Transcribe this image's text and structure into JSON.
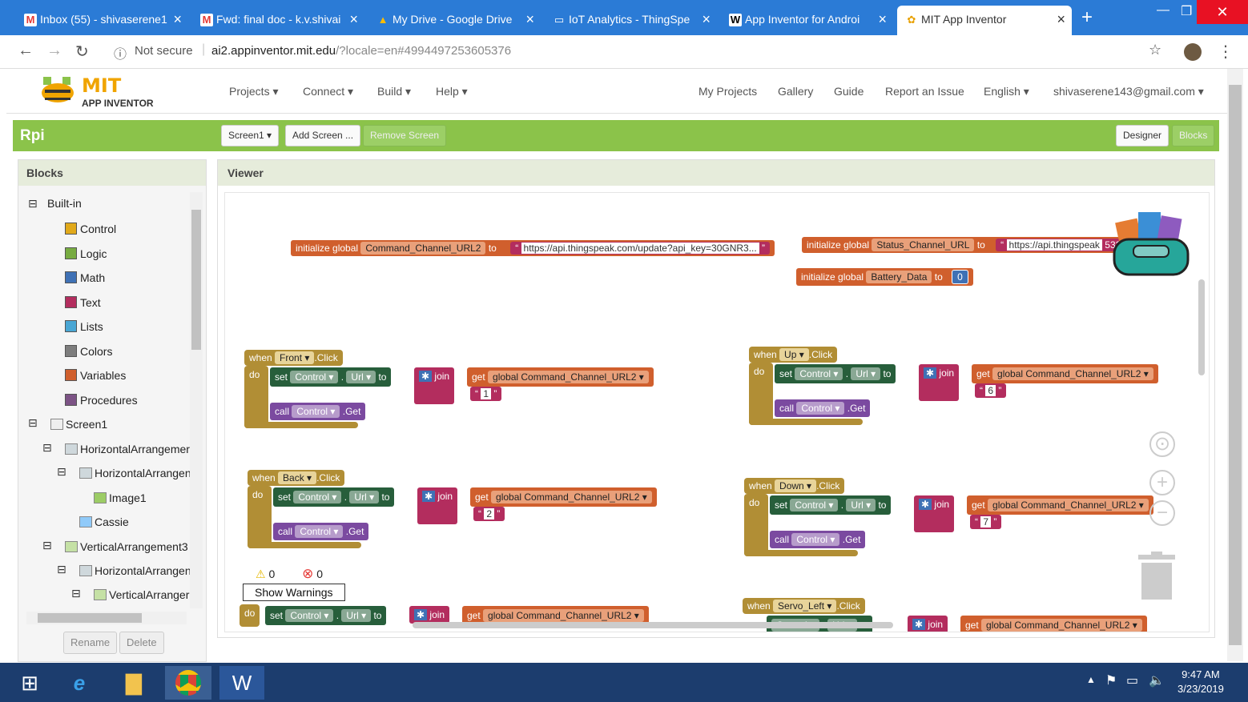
{
  "browser": {
    "tabs": [
      {
        "icon": "gmail-icon",
        "glyph": "M",
        "title": "Inbox (55) - shivaserene1",
        "left": 0
      },
      {
        "icon": "gmail-icon",
        "glyph": "M",
        "title": "Fwd: final doc - k.v.shivai",
        "left": 0
      },
      {
        "icon": "drive-icon",
        "glyph": "▲",
        "title": "My Drive - Google Drive",
        "left": 0
      },
      {
        "icon": "thingspeak-icon",
        "glyph": "▭",
        "title": "IoT Analytics - ThingSpe",
        "left": 0
      },
      {
        "icon": "wikipedia-icon",
        "glyph": "W",
        "title": "App Inventor for Androi",
        "left": 0
      },
      {
        "icon": "appinventor-icon",
        "glyph": "✿",
        "title": "MIT App Inventor",
        "left": 0
      }
    ],
    "not_secure": "Not secure",
    "url_host": "ai2.appinventor.mit.edu",
    "url_rest": "/?locale=en#4994497253605376"
  },
  "app": {
    "logo_mit": "MIT",
    "logo_sub": "APP INVENTOR",
    "menu": [
      "Projects ▾",
      "Connect ▾",
      "Build ▾",
      "Help ▾"
    ],
    "right_menu": [
      "My Projects",
      "Gallery",
      "Guide",
      "Report an Issue",
      "English ▾",
      "shivaserene143@gmail.com ▾"
    ],
    "project": "Rpi",
    "screen_btn": "Screen1 ▾",
    "add_screen": "Add Screen ...",
    "remove_screen": "Remove Screen",
    "designer": "Designer",
    "blocks": "Blocks"
  },
  "left": {
    "header": "Blocks",
    "builtin": "Built-in",
    "categories": [
      {
        "label": "Control",
        "color": "#e1a91a"
      },
      {
        "label": "Logic",
        "color": "#77ab41"
      },
      {
        "label": "Math",
        "color": "#3f71b5"
      },
      {
        "label": "Text",
        "color": "#b32d5e"
      },
      {
        "label": "Lists",
        "color": "#49a6d4"
      },
      {
        "label": "Colors",
        "color": "#7d7d7d"
      },
      {
        "label": "Variables",
        "color": "#d05f2d"
      },
      {
        "label": "Procedures",
        "color": "#7c5385"
      }
    ],
    "components": [
      "Screen1",
      "HorizontalArrangemer",
      "HorizontalArrangen",
      "Image1",
      "Cassie",
      "VerticalArrangement3",
      "HorizontalArrangen",
      "VerticalArranger"
    ],
    "rename": "Rename",
    "delete": "Delete"
  },
  "viewer": {
    "header": "Viewer",
    "warnings_count": "0",
    "errors_count": "0",
    "show_warnings": "Show Warnings",
    "globals": {
      "g1_name": "Command_Channel_URL2",
      "g1_value": "https://api.thingspeak.com/update?api_key=30GNR3...",
      "g2_name": "Status_Channel_URL",
      "g2_value": "https://api.thingspeak",
      "g2_tail": "5328",
      "g3_name": "Battery_Data",
      "g3_value": "0"
    },
    "events": [
      {
        "button": "Front",
        "num": "1"
      },
      {
        "button": "Up",
        "num": "6"
      },
      {
        "button": "Back",
        "num": "2"
      },
      {
        "button": "Down",
        "num": "7"
      },
      {
        "button": "Servo_Left",
        "num": ""
      }
    ],
    "kw": {
      "init": "initialize global",
      "to": "to",
      "when": "when",
      "click": ".Click",
      "do": "do",
      "set": "set",
      "control": "Control ▾",
      "url": "Url ▾",
      "join": "join",
      "get": "get",
      "global_var": "global Command_Channel_URL2 ▾",
      "call": "call",
      "get_method": ".Get"
    }
  },
  "taskbar": {
    "time": "9:47 AM",
    "date": "3/23/2019"
  }
}
